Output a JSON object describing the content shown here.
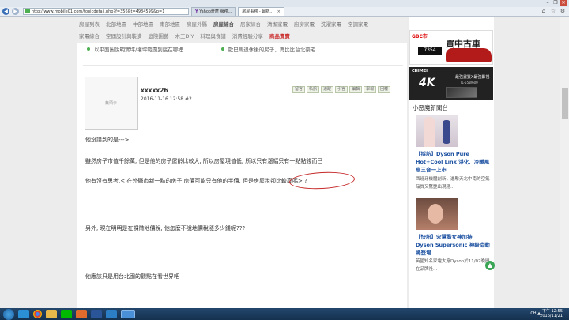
{
  "browser": {
    "url": "http://www.mobile01.com/topicdetail.php?f=356&t=4984599&p=1",
    "tabs": [
      {
        "label": "Yahoo奇摩 服務..."
      },
      {
        "label": "房屋事務 - 最新..."
      }
    ],
    "tab_icon_label": "Y",
    "nav_back": "◀",
    "nav_forward": "▶",
    "tab_close": "×",
    "toolbar_icons": [
      "home-icon",
      "star-icon",
      "gear-icon"
    ],
    "window_controls": [
      "–",
      "❐",
      "✕"
    ]
  },
  "nav": {
    "row1": [
      "房屋列表",
      "北部地區",
      "中部地區",
      "南部地區",
      "房屋外縣",
      "房屋綜合",
      "居家綜合",
      "清潔家電",
      "廚房家電",
      "洗濯家電",
      "空調家電"
    ],
    "row1_bold": "房屋綜合",
    "row2": [
      "家電綜合",
      "空間設計與裝潢",
      "庭院園藝",
      "木工DIY",
      "料理與食譜",
      "消費經驗分享",
      "商品賣賣"
    ],
    "row2_active": "商品賣賣"
  },
  "bullets": [
    "以平面圖說明實坪/權坪範圍到底在哪裡",
    "歐巴馬退休後的房子，再比比台北豪宅"
  ],
  "post": {
    "avatar_text": "無頭示",
    "username": "xxxxx26",
    "meta": "2016-11-16 12:58  #2",
    "actions": [
      "留言",
      "私訊",
      "追蹤",
      "引言",
      "編輯",
      "舉報",
      "回覆"
    ],
    "lines": [
      "他沒講到的是--->",
      "雖然房子市值千餘萬, 但是他的房子屋齡比較大, 所以房屋現值低, 所以只有漲幅只有一點點錢而已",
      "他有沒有思考,< 在外縣市新一點的房子,房價可能只有他的半價, 但是房屋稅卻比較高嗎> ?",
      "另外, 現在明明是在課徵地價稅, 他怎麼不說地價稅漲多少錢呢???",
      "他應該只是用台北國的觀點在看世界吧"
    ]
  },
  "ads": {
    "ad1": {
      "brand": "GBC市",
      "headline": "買中古車",
      "plate": "7354"
    },
    "ad2": {
      "brand": "CHIMEI",
      "big": "4K",
      "tag": "最強畫質X最強影視",
      "model": "TL-55W600"
    }
  },
  "sidebar": {
    "section_title": "小惡魔新聞台",
    "items": [
      {
        "title": "【採訪】Dyson Pure Hot+Cool Link 淨化、冷暖風扇三合一上市",
        "desc": "西班牙機體創新，進擊天北中南的空氣品質又驚艷出現隱..."
      },
      {
        "title": "【快訊】宋慧喬女神加持 Dyson Supersonic 神級造動將登場",
        "desc": "英國知名家電大廠Dyson於11/07晚間在品牌社..."
      }
    ],
    "fab_icon": "▲"
  },
  "taskbar": {
    "clock_time": "下午 12:55",
    "clock_date": "2016/11/21",
    "tray": "CH ▲"
  }
}
